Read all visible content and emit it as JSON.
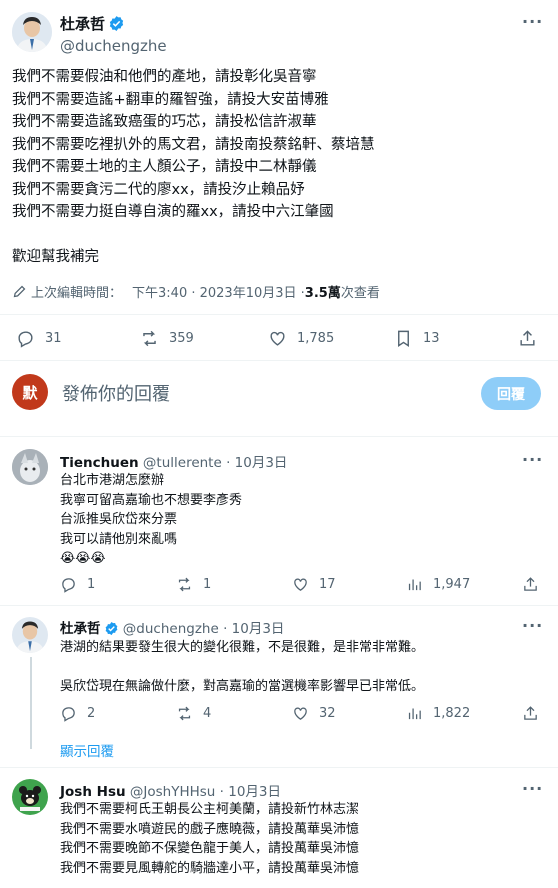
{
  "main_post": {
    "author_name": "杜承哲",
    "handle": "@duchengzhe",
    "lines": [
      "我們不需要假油和他們的產地，請投彰化吳音寧",
      "我們不需要造謠+翻車的羅智強，請投大安苗博雅",
      "我們不需要造謠致癌蛋的巧芯，請投松信許淑華",
      "我們不需要吃裡扒外的馬文君，請投南投蔡銘軒、蔡培慧",
      "我們不需要土地的主人顏公子，請投中二林靜儀",
      "我們不需要貪污二代的廖xx，請投汐止賴品妤",
      "我們不需要力挺自導自演的羅xx，請投中六江肇國"
    ],
    "closing": "歡迎幫我補完",
    "edited_label": "上次編輯時間：",
    "timestamp": "下午3:40 · 2023年10月3日 · ",
    "views_count": "3.5萬",
    "views_label": " 次查看",
    "replies": "31",
    "retweets": "359",
    "likes": "1,785",
    "bookmarks": "13"
  },
  "reply_box": {
    "avatar_char": "默",
    "placeholder": "發佈你的回覆",
    "button_label": "回覆"
  },
  "replies": [
    {
      "author_name": "Tienchuen",
      "handle": "@tullerente",
      "date": " · 10月3日",
      "lines": [
        "台北市港湖怎麼辦",
        "我寧可留高嘉瑜也不想要李彥秀",
        "台派推吳欣岱來分票",
        "我可以請他別來亂嗎",
        "😭😭😭"
      ],
      "replies": "1",
      "retweets": "1",
      "likes": "17",
      "views": "1,947"
    },
    {
      "author_name": "杜承哲",
      "handle": "@duchengzhe",
      "date": " · 10月3日",
      "lines": [
        "港湖的結果要發生很大的變化很難，不是很難，是非常非常難。",
        "",
        "吳欣岱現在無論做什麼，對高嘉瑜的當選機率影響早已非常低。"
      ],
      "replies": "2",
      "retweets": "4",
      "likes": "32",
      "views": "1,822"
    },
    {
      "author_name": "Josh Hsu",
      "handle": "@JoshYHHsu",
      "date": " · 10月3日",
      "lines": [
        "我們不需要柯氏王朝長公主柯美蘭，請投新竹林志潔",
        "我們不需要水噴遊民的戲子應曉薇，請投萬華吳沛憶",
        "我們不需要晚節不保變色龍于美人，請投萬華吳沛憶",
        "我們不需要見風轉舵的騎牆達小平，請投萬華吳沛憶"
      ]
    }
  ],
  "show_replies_label": "顯示回覆",
  "colors": {
    "accent": "#1d9bf0",
    "reply_button_bg": "#8ecdf8",
    "avatar_default_bg": "#c1391b"
  }
}
